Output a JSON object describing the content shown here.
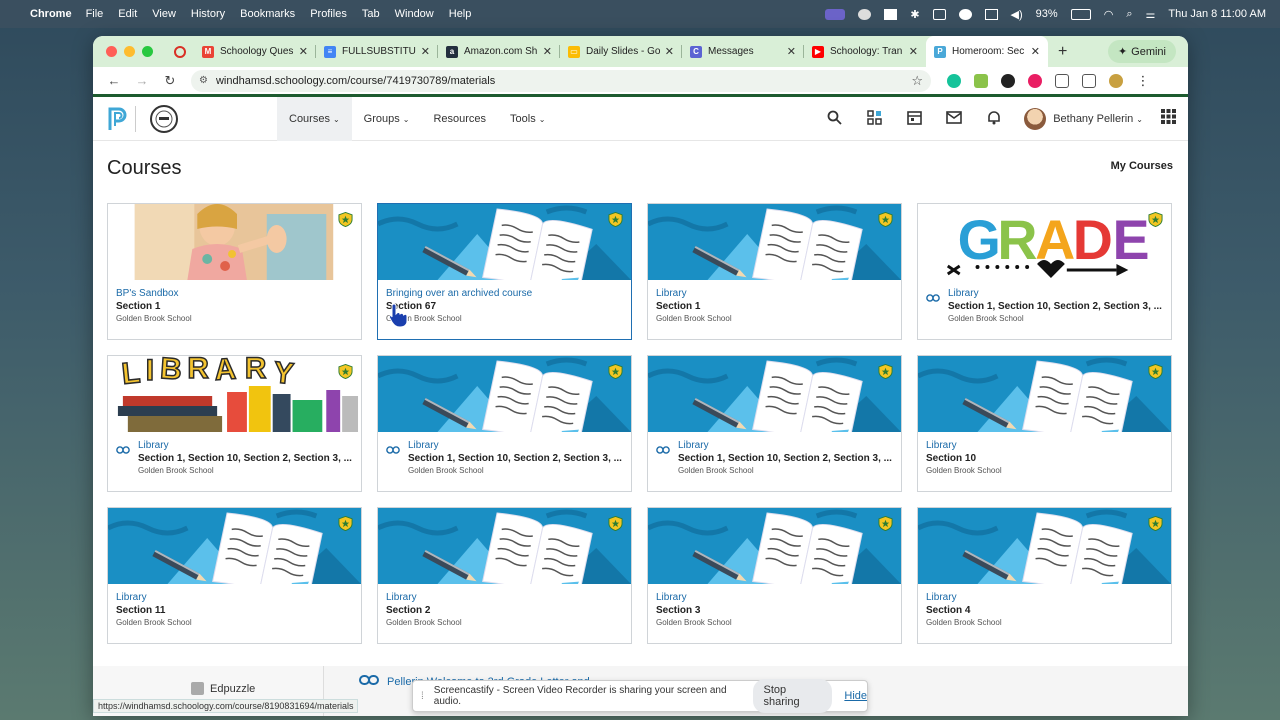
{
  "menubar": {
    "apple": "",
    "app": "Chrome",
    "items": [
      "File",
      "Edit",
      "View",
      "History",
      "Bookmarks",
      "Profiles",
      "Tab",
      "Window",
      "Help"
    ],
    "battery": "93%",
    "datetime": "Thu Jan 8  11:00 AM"
  },
  "tabs": [
    {
      "title": "Schoology Ques",
      "color": "#ea4335",
      "glyph": "M"
    },
    {
      "title": "FULLSUBSTITU",
      "color": "#4285f4",
      "glyph": "≡"
    },
    {
      "title": "Amazon.com Sh",
      "color": "#232f3e",
      "glyph": "a"
    },
    {
      "title": "Daily Slides - Go",
      "color": "#fbbc04",
      "glyph": "▭"
    },
    {
      "title": "Messages",
      "color": "#5b63d3",
      "glyph": "C"
    },
    {
      "title": "Schoology: Tran",
      "color": "#ff0000",
      "glyph": "▶"
    },
    {
      "title": "Homeroom: Sec",
      "color": "#4aa8d8",
      "glyph": "P"
    }
  ],
  "gemini_label": "Gemini",
  "url": "windhamsd.schoology.com/course/7419730789/materials",
  "nav": {
    "courses": "Courses",
    "groups": "Groups",
    "resources": "Resources",
    "tools": "Tools"
  },
  "user_name": "Bethany Pellerin",
  "page_title": "Courses",
  "my_courses": "My Courses",
  "school": "Golden Brook School",
  "cards": [
    {
      "name": "BP's Sandbox",
      "section": "Section 1",
      "school": "Golden Brook School",
      "image": "sandbox",
      "linked": false
    },
    {
      "name": "Bringing over an archived course",
      "section": "Section 67",
      "school": "Golden Brook School",
      "image": "default",
      "linked": false
    },
    {
      "name": "Library",
      "section": "Section 1",
      "school": "Golden Brook School",
      "image": "default",
      "linked": false
    },
    {
      "name": "Library",
      "section": "Section 1, Section 10, Section 2, Section 3, ...",
      "school": "Golden Brook School",
      "image": "grade",
      "linked": true
    },
    {
      "name": "Library",
      "section": "Section 1, Section 10, Section 2, Section 3, ...",
      "school": "Golden Brook School",
      "image": "library",
      "linked": true
    },
    {
      "name": "Library",
      "section": "Section 1, Section 10, Section 2, Section 3, ...",
      "school": "Golden Brook School",
      "image": "default",
      "linked": true
    },
    {
      "name": "Library",
      "section": "Section 1, Section 10, Section 2, Section 3, ...",
      "school": "Golden Brook School",
      "image": "default",
      "linked": true
    },
    {
      "name": "Library",
      "section": "Section 10",
      "school": "Golden Brook School",
      "image": "default",
      "linked": false
    },
    {
      "name": "Library",
      "section": "Section 11",
      "school": "Golden Brook School",
      "image": "default",
      "linked": false
    },
    {
      "name": "Library",
      "section": "Section 2",
      "school": "Golden Brook School",
      "image": "default",
      "linked": false
    },
    {
      "name": "Library",
      "section": "Section 3",
      "school": "Golden Brook School",
      "image": "default",
      "linked": false
    },
    {
      "name": "Library",
      "section": "Section 4",
      "school": "Golden Brook School",
      "image": "default",
      "linked": false
    }
  ],
  "behind": {
    "edpuzzle": "Edpuzzle",
    "pellerin": "Pellerin Welcome to 3rd Grade Letter and..."
  },
  "status_url": "https://windhamsd.schoology.com/course/8190831694/materials",
  "share_bar": {
    "message": "Screencastify - Screen Video Recorder is sharing your screen and audio.",
    "stop": "Stop sharing",
    "hide": "Hide"
  },
  "colors": {
    "tabstrip": "#d9efd7",
    "link_blue": "#1a6aa8",
    "default_card_blue": "#1a8fc4"
  }
}
